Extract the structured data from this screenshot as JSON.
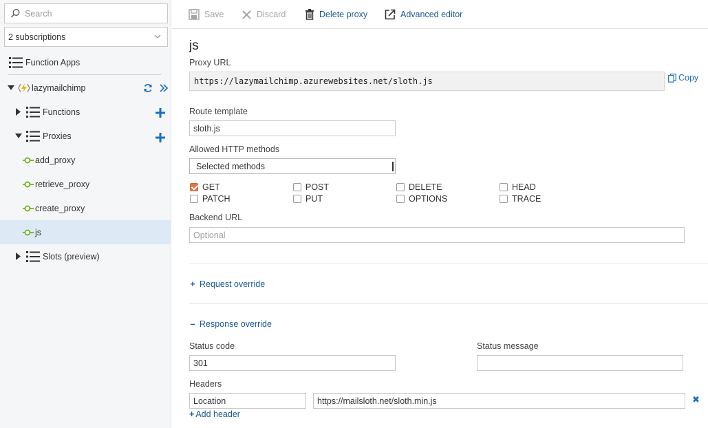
{
  "sidebar": {
    "search_placeholder": "Search",
    "subscriptions": "2 subscriptions",
    "function_apps": "Function Apps",
    "app_name": "lazymailchimp",
    "functions": "Functions",
    "proxies": "Proxies",
    "proxy_items": [
      "add_proxy",
      "retrieve_proxy",
      "create_proxy",
      "js"
    ],
    "slots": "Slots (preview)"
  },
  "toolbar": {
    "save": "Save",
    "discard": "Discard",
    "delete_proxy": "Delete proxy",
    "advanced_editor": "Advanced editor"
  },
  "proxy": {
    "name": "js",
    "proxy_url_label": "Proxy URL",
    "proxy_url": "https://lazymailchimp.azurewebsites.net/sloth.js",
    "copy": "Copy",
    "route_template_label": "Route template",
    "route_template": "sloth.js",
    "allowed_methods_label": "Allowed HTTP methods",
    "allowed_methods_value": "Selected methods",
    "methods": {
      "get": "GET",
      "post": "POST",
      "delete": "DELETE",
      "head": "HEAD",
      "patch": "PATCH",
      "put": "PUT",
      "options": "OPTIONS",
      "trace": "TRACE"
    },
    "backend_url_label": "Backend URL",
    "backend_url_placeholder": "Optional",
    "request_override": "Request override",
    "response_override": "Response override",
    "status_code_label": "Status code",
    "status_code": "301",
    "status_message_label": "Status message",
    "status_message": "",
    "headers_label": "Headers",
    "header_name": "Location",
    "header_value": "https://mailsloth.net/sloth.min.js",
    "add_header": "Add header"
  },
  "colors": {
    "accent": "#1a5a96",
    "link": "#1a6fc4",
    "selected_row": "#dde9f5",
    "proxy_icon": "#7ab929",
    "bolt": "#f5b400",
    "checkbox_checked": "#e37643"
  }
}
